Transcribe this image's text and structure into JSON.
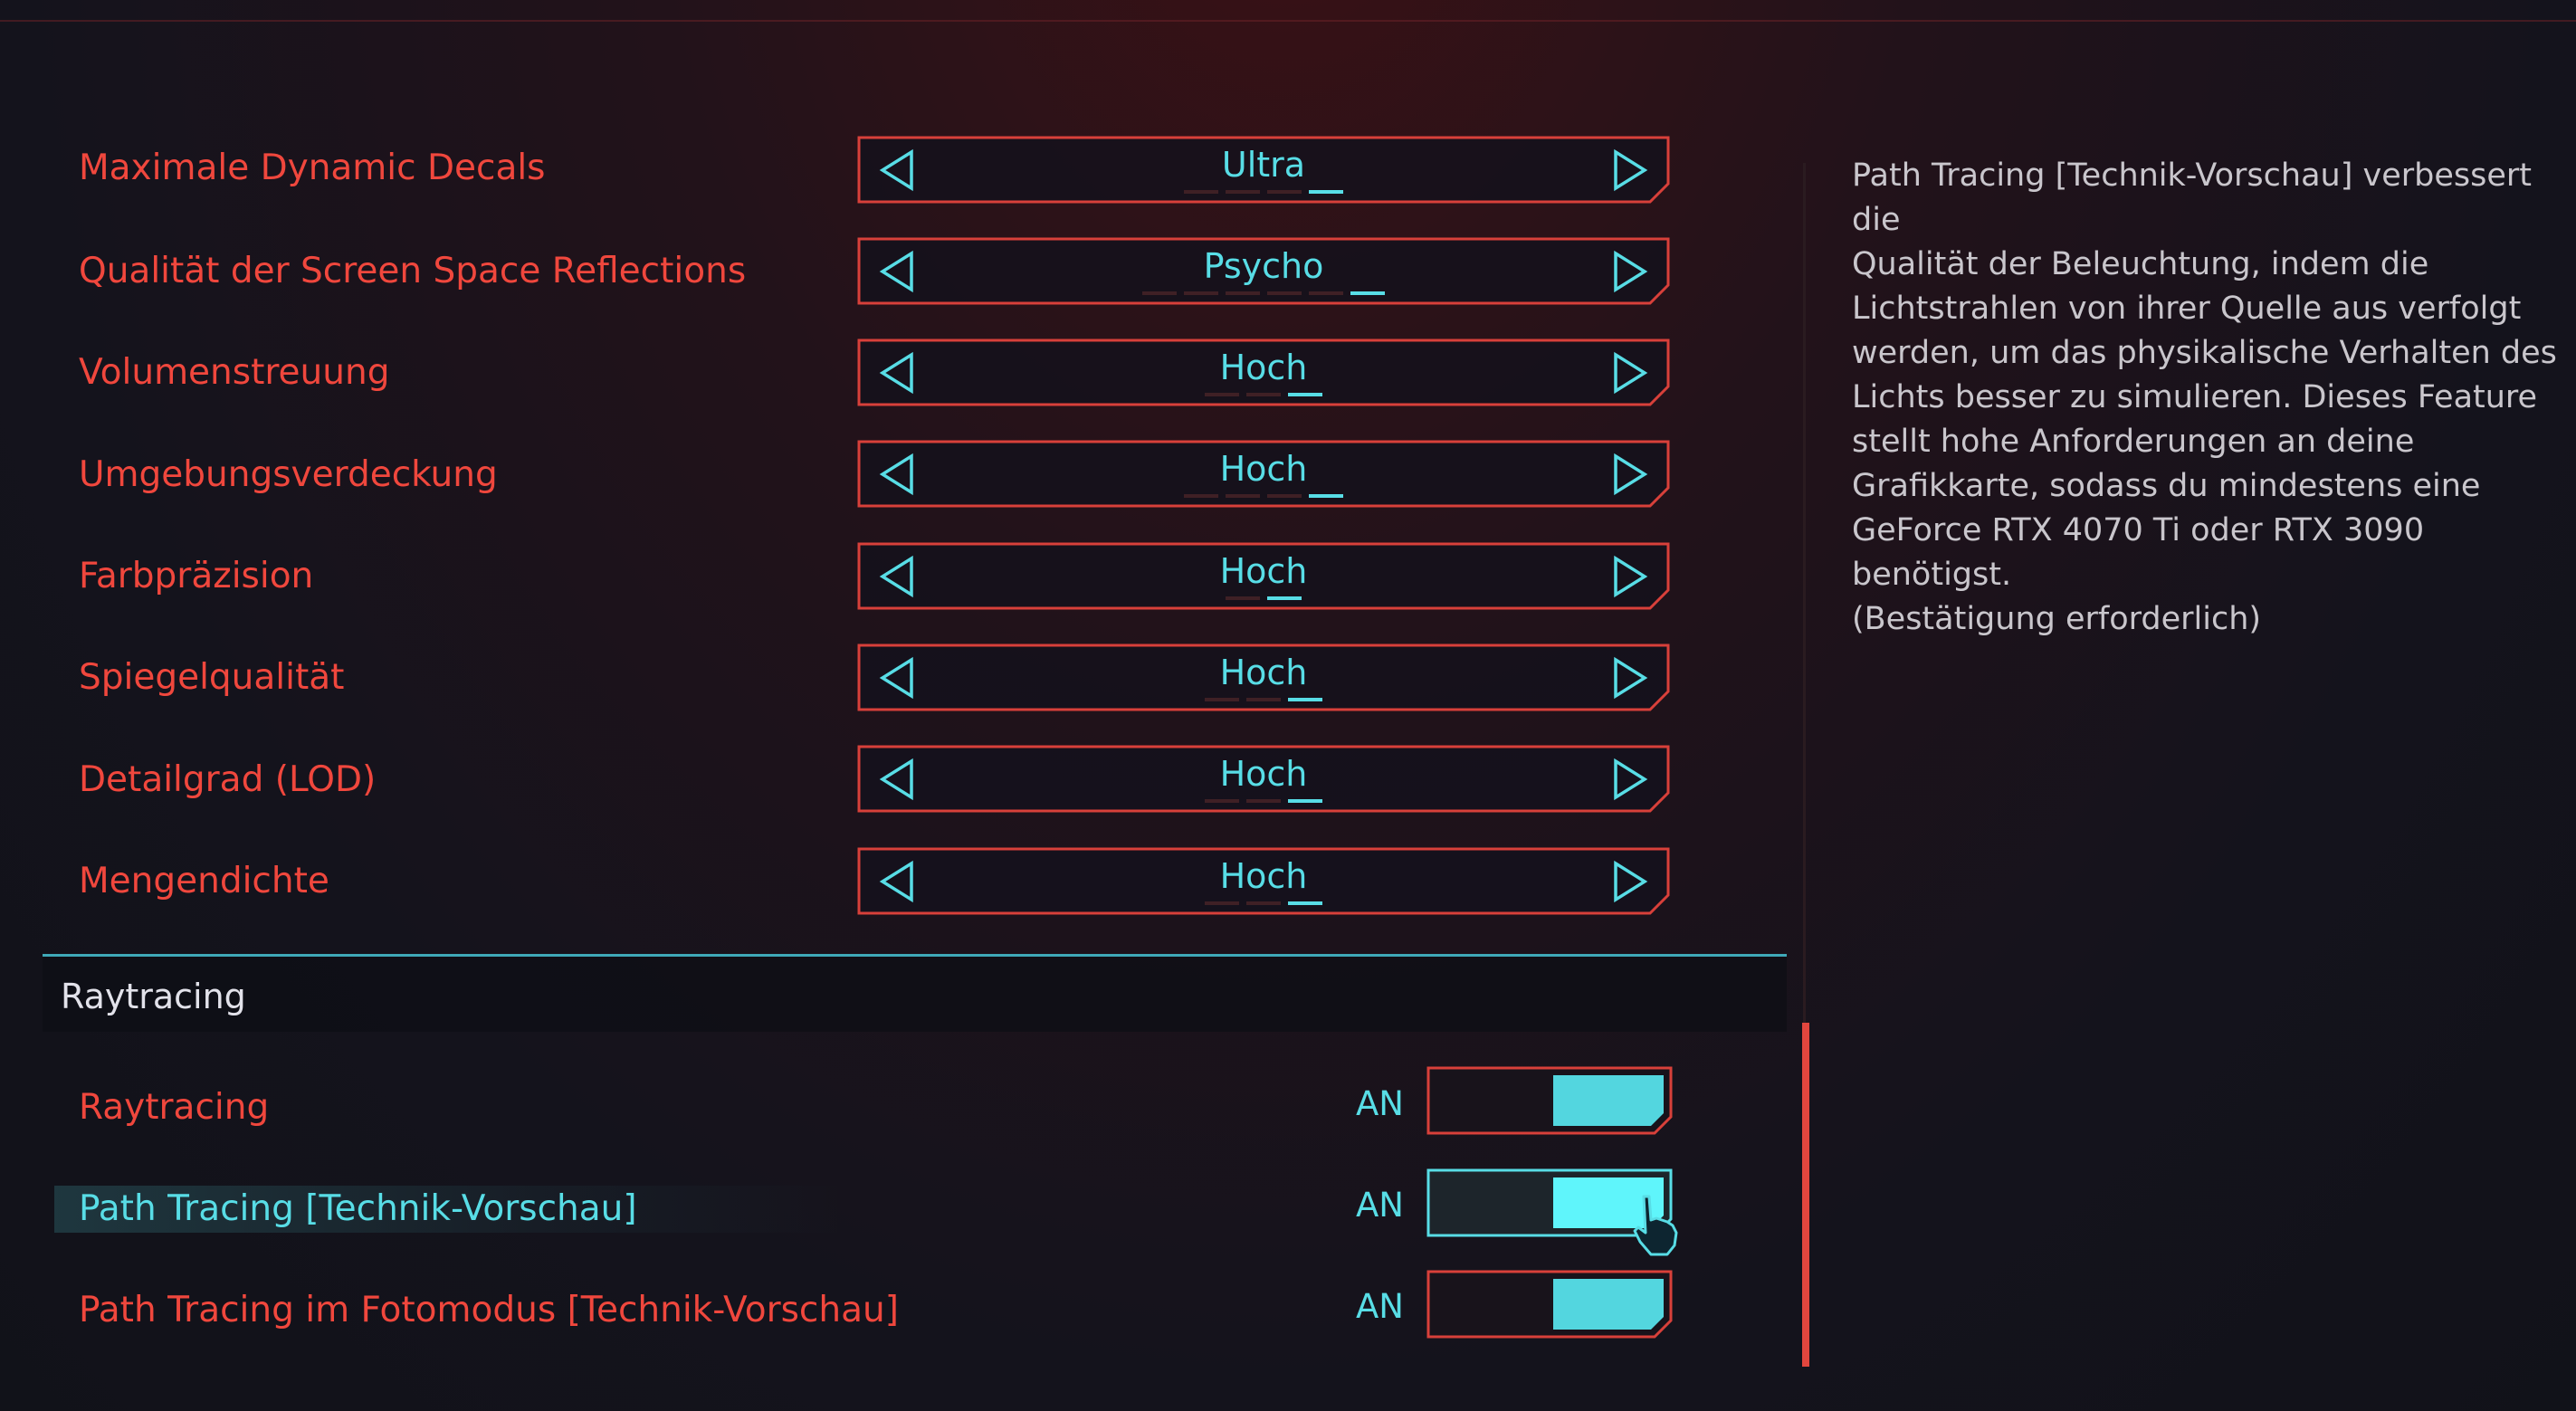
{
  "settings": [
    {
      "label": "Maximale Dynamic Decals",
      "value": "Ultra",
      "steps": 4,
      "selected": 3
    },
    {
      "label": "Qualität der Screen Space Reflections",
      "value": "Psycho",
      "steps": 6,
      "selected": 5
    },
    {
      "label": "Volumenstreuung",
      "value": "Hoch",
      "steps": 3,
      "selected": 2
    },
    {
      "label": "Umgebungsverdeckung",
      "value": "Hoch",
      "steps": 4,
      "selected": 3
    },
    {
      "label": "Farbpräzision",
      "value": "Hoch",
      "steps": 2,
      "selected": 1
    },
    {
      "label": "Spiegelqualität",
      "value": "Hoch",
      "steps": 3,
      "selected": 2
    },
    {
      "label": "Detailgrad (LOD)",
      "value": "Hoch",
      "steps": 3,
      "selected": 2
    },
    {
      "label": "Mengendichte",
      "value": "Hoch",
      "steps": 3,
      "selected": 2
    }
  ],
  "section": {
    "title": "Raytracing"
  },
  "toggles": [
    {
      "label": "Raytracing",
      "state": "AN",
      "on": true,
      "focused": false
    },
    {
      "label": "Path Tracing [Technik-Vorschau]",
      "state": "AN",
      "on": true,
      "focused": true
    },
    {
      "label": "Path Tracing im Fotomodus [Technik-Vorschau]",
      "state": "AN",
      "on": true,
      "focused": false
    }
  ],
  "description": "Path Tracing [Technik-Vorschau] verbessert die\nQualität der Beleuchtung, indem die\nLichtstrahlen von ihrer Quelle aus verfolgt\nwerden, um das physikalische Verhalten des\nLichts besser zu simulieren. Dieses Feature\nstellt hohe Anforderungen an deine\nGrafikkarte, sodass du mindestens eine\nGeForce RTX 4070 Ti oder RTX 3090 benötigst.\n(Bestätigung erforderlich)",
  "colors": {
    "accent": "#58dde6",
    "label": "#f0473d",
    "frame": "#d8403a"
  },
  "icons": {
    "left": "arrow-left-icon",
    "right": "arrow-right-icon",
    "cursor": "hand-pointer-icon"
  }
}
